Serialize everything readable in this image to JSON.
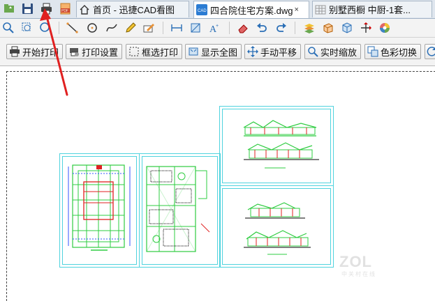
{
  "tabs": [
    {
      "label": "首页 - 迅捷CAD看图",
      "icon": "home-icon"
    },
    {
      "label": "四合院住宅方案.dwg",
      "icon": "cad-file-icon",
      "close": "×"
    },
    {
      "label": "别墅西橱 中厨-1套...",
      "icon": "grid-file-icon"
    }
  ],
  "quick_icons": [
    "open-folder-icon",
    "save-icon",
    "print-icon",
    "pdf-export-icon"
  ],
  "command_buttons": [
    {
      "label": "开始打印",
      "icon": "printer-icon"
    },
    {
      "label": "打印设置",
      "icon": "print-settings-icon"
    },
    {
      "label": "框选打印",
      "icon": "select-box-icon"
    },
    {
      "label": "显示全图",
      "icon": "fit-view-icon"
    },
    {
      "label": "手动平移",
      "icon": "pan-icon"
    },
    {
      "label": "实时缩放",
      "icon": "zoom-icon"
    },
    {
      "label": "色彩切换",
      "icon": "color-switch-icon"
    }
  ],
  "watermark": {
    "brand": "ZOL",
    "sub": "中关村在线"
  },
  "colors": {
    "accent": "#2b7cd3",
    "drawing_frame": "#4fd3de",
    "annotation_arrow": "#e02020"
  }
}
